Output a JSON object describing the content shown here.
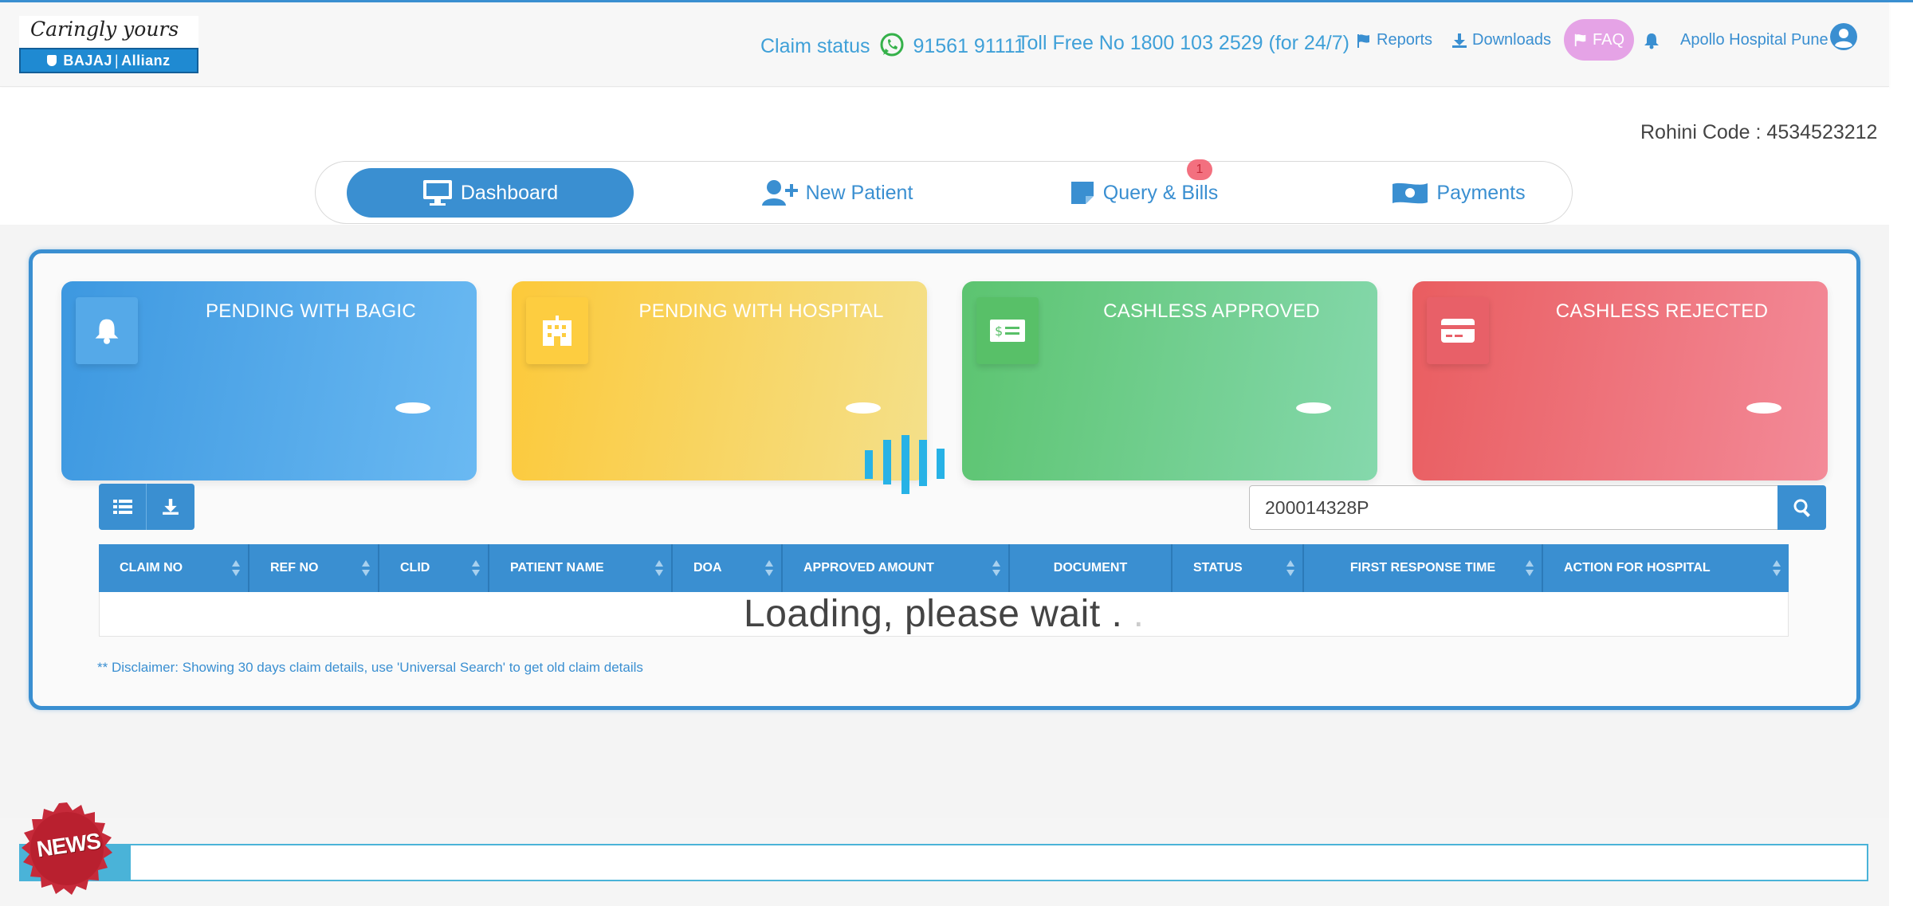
{
  "header": {
    "logo_tagline": "Caringly yours",
    "logo_brand": "BAJAJ",
    "logo_brand_2": "Allianz",
    "claim_status_label": "Claim status",
    "claim_status_number": "91561 91111",
    "toll_free": "Toll Free No 1800 103 2529 (for 24/7)",
    "reports_label": "Reports",
    "downloads_label": "Downloads",
    "faq_label": "FAQ",
    "user_name": "Apollo Hospital Pune"
  },
  "rohini_code": "Rohini Code : 4534523212",
  "tabs": [
    {
      "label": "Dashboard",
      "icon": "monitor-icon",
      "active": true
    },
    {
      "label": "New Patient",
      "icon": "user-plus-icon",
      "active": false
    },
    {
      "label": "Query & Bills",
      "icon": "note-icon",
      "active": false,
      "badge": "1"
    },
    {
      "label": "Payments",
      "icon": "money-icon",
      "active": false
    }
  ],
  "cards": [
    {
      "title": "PENDING WITH BAGIC",
      "icon": "bell-icon"
    },
    {
      "title": "PENDING WITH HOSPITAL",
      "icon": "hospital-icon"
    },
    {
      "title": "CASHLESS APPROVED",
      "icon": "money-bill-icon"
    },
    {
      "title": "CASHLESS REJECTED",
      "icon": "credit-card-icon"
    }
  ],
  "search": {
    "value": "200014328P"
  },
  "table": {
    "columns": [
      "CLAIM NO",
      "REF NO",
      "CLID",
      "PATIENT NAME",
      "DOA",
      "APPROVED AMOUNT",
      "DOCUMENT",
      "STATUS",
      "FIRST RESPONSE TIME",
      "ACTION FOR HOSPITAL"
    ],
    "loading_text": "Loading, please wait ."
  },
  "disclaimer": "** Disclaimer: Showing 30 days claim details, use 'Universal Search' to get old claim details",
  "news_label": "NEWS",
  "colors": {
    "primary": "#3a8fd1",
    "faq": "#e5a3e6",
    "pending_bagic": "#3d98e0",
    "pending_hospital": "#fcc93a",
    "approved": "#5cc470",
    "rejected": "#e95d60",
    "news_badge": "#c62a3a"
  }
}
